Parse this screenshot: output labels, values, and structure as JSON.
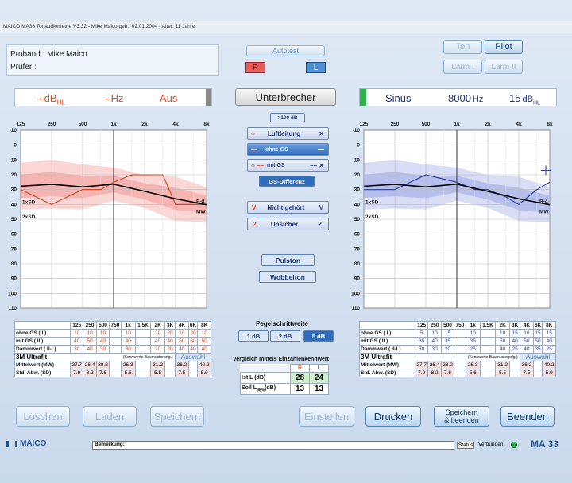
{
  "window": {
    "title": "MAICO MA33 Tonaudiometrie V3.32 - Mike Maico    geb.: 02.01.2004 - Alter: 11 Jahre"
  },
  "patient": {
    "proband": "Proband : Mike Maico",
    "pruefer": "Prüfer    :"
  },
  "autotest": "Autotest",
  "side": {
    "r": "R",
    "l": "L"
  },
  "mode": {
    "ton": "Ton",
    "pilot": "Pilot",
    "laerm1": "Lärm I",
    "laerm2": "Lärm II"
  },
  "left_display": {
    "db": "--dB",
    "db_sub": "HL",
    "hz": "--Hz",
    "state": "Aus"
  },
  "unterbrecher": "Unterbrecher",
  "right_display": {
    "type": "Sinus",
    "freq": "8000",
    "freq_unit": "Hz",
    "level": "15",
    "level_unit": "dB",
    "level_sub": "HL"
  },
  "legend": {
    "over100": ">100 dB",
    "luftleitung": "Luftleitung",
    "ohne_gs": "ohne GS",
    "mit_gs": "mit GS",
    "gs_diff": "GS-Differenz",
    "nicht": "Nicht gehört",
    "unsicher": "Unsicher",
    "pulston": "Pulston",
    "wobbelton": "Wobbelton"
  },
  "freq_labels": [
    "125",
    "250",
    "500",
    "1k",
    "2k",
    "4k",
    "8k"
  ],
  "db_labels": [
    "-10",
    "0",
    "10",
    "20",
    "30",
    "40",
    "50",
    "60",
    "70",
    "80",
    "90",
    "100",
    "110"
  ],
  "chart_labels": {
    "sd1": "1xSD",
    "sd2": "2xSD",
    "mw": "MW",
    "b8": "B-8",
    "b4": "B-4"
  },
  "chart_data": [
    {
      "type": "line",
      "ear": "right",
      "x": [
        125,
        250,
        500,
        750,
        1000,
        1500,
        2000,
        3000,
        4000,
        6000,
        8000
      ],
      "x_ticks": [
        "125",
        "250",
        "500",
        "1k",
        "2k",
        "4k",
        "8k"
      ],
      "ylim": [
        110,
        -10
      ],
      "series": [
        {
          "values": [
            30,
            40,
            30,
            30,
            25,
            20,
            20,
            20,
            40,
            40,
            40
          ],
          "color": "#c8401a"
        },
        {
          "name": "MW",
          "values": [
            27.7,
            26.4,
            28.2,
            null,
            26.3,
            null,
            31.2,
            null,
            36.2,
            null,
            40.2
          ],
          "color": "#000000"
        }
      ]
    },
    {
      "type": "line",
      "ear": "left",
      "x": [
        125,
        250,
        500,
        750,
        1000,
        1500,
        2000,
        3000,
        4000,
        6000,
        8000
      ],
      "x_ticks": [
        "125",
        "250",
        "500",
        "1k",
        "2k",
        "4k",
        "8k"
      ],
      "ylim": [
        110,
        -10
      ],
      "series": [
        {
          "values": [
            30,
            30,
            20,
            null,
            25,
            30,
            30,
            35,
            40,
            30,
            25
          ],
          "color": "#2a3a8c"
        },
        {
          "name": "MW",
          "values": [
            27.7,
            26.4,
            28.2,
            null,
            26.3,
            null,
            31.2,
            null,
            36.2,
            null,
            40.2
          ],
          "color": "#000000"
        }
      ]
    }
  ],
  "table": {
    "freqs": [
      "125",
      "250",
      "500",
      "750",
      "1k",
      "1.5K",
      "2K",
      "3K",
      "4K",
      "6K",
      "8K"
    ],
    "rows_left": [
      {
        "label": "ohne GS ( I )",
        "vals": [
          "10",
          "10",
          "10",
          "",
          "10",
          "",
          "20",
          "20",
          "10",
          "20",
          "10"
        ]
      },
      {
        "label": "mit GS ( II )",
        "vals": [
          "40",
          "50",
          "40",
          "",
          "40",
          "",
          "40",
          "40",
          "50",
          "60",
          "50"
        ]
      },
      {
        "label": "Dammwert ( II-I )",
        "vals": [
          "30",
          "40",
          "30",
          "",
          "30",
          "",
          "20",
          "20",
          "40",
          "40",
          "40"
        ]
      }
    ],
    "rows_right": [
      {
        "label": "ohne GS ( I )",
        "vals": [
          "5",
          "10",
          "15",
          "",
          "10",
          "",
          "10",
          "15",
          "10",
          "15",
          "15"
        ]
      },
      {
        "label": "mit GS ( II )",
        "vals": [
          "35",
          "40",
          "35",
          "",
          "35",
          "",
          "50",
          "40",
          "50",
          "50",
          "40"
        ]
      },
      {
        "label": "Dammwert ( II-I )",
        "vals": [
          "30",
          "30",
          "20",
          "",
          "25",
          "",
          "40",
          "25",
          "40",
          "35",
          "25"
        ]
      }
    ],
    "ultrafit": "3M Ultrafit",
    "kennwerte": "(Kennwerte Baumusterprfg.)",
    "auswahl": "Auswahl",
    "mw_label": "Mittelwert (MW)",
    "sd_label": "Std. Abw. (SD)",
    "mw": [
      "27.7",
      "26.4",
      "28.2",
      "",
      "26.3",
      "",
      "31.2",
      "",
      "36.2",
      "",
      "40.2"
    ],
    "sd": [
      "7.9",
      "8.2",
      "7.6",
      "",
      "5.6",
      "",
      "5.5",
      "",
      "7.5",
      "",
      "5.9"
    ]
  },
  "pegel": {
    "title": "Pegelschrittweite",
    "o1": "1 dB",
    "o2": "2 dB",
    "o3": "5 dB"
  },
  "vergleich": {
    "title": "Vergleich mittels Einzahlenkennwert",
    "r": "R",
    "l": "L",
    "ist": "Ist  L  (dB)",
    "soll": "Soll L",
    "soll_sub": "98%",
    "soll_unit": "(dB)",
    "ist_r": "28",
    "ist_l": "24",
    "soll_r": "13",
    "soll_l": "13"
  },
  "buttons": {
    "loeschen": "Löschen",
    "laden": "Laden",
    "speichern": "Speichern",
    "einstellen": "Einstellen",
    "drucken": "Drucken",
    "speichern_beenden_1": "Speichern",
    "speichern_beenden_2": "& beenden",
    "beenden": "Beenden"
  },
  "status": {
    "brand": "MAICO",
    "bemerkung": "Bemerkung:",
    "status": "Status",
    "verbunden": "Verbunden",
    "model": "MA 33"
  }
}
